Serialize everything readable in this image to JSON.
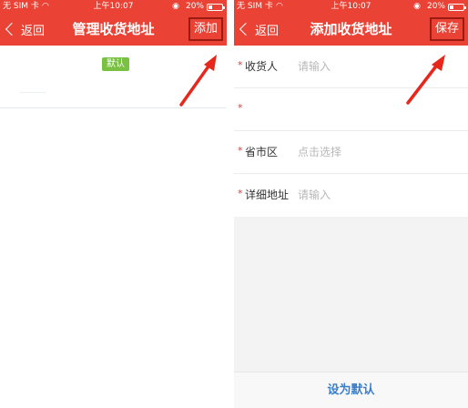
{
  "left": {
    "status": {
      "carrier": "无 SIM 卡",
      "time": "上午10:07",
      "battery": "20%"
    },
    "nav": {
      "back": "返回",
      "title": "管理收货地址",
      "action": "添加"
    },
    "badge": "默认"
  },
  "right": {
    "status": {
      "carrier": "无 SIM 卡",
      "time": "上午10:07",
      "battery": "20%"
    },
    "nav": {
      "back": "返回",
      "title": "添加收货地址",
      "action": "保存"
    },
    "form": {
      "rows": [
        {
          "star": "*",
          "label": "收货人",
          "placeholder": "请输入"
        },
        {
          "star": "*",
          "label": "",
          "placeholder": ""
        },
        {
          "star": "*",
          "label": "省市区",
          "placeholder": "点击选择"
        },
        {
          "star": "*",
          "label": "详细地址",
          "placeholder": "请输入"
        }
      ]
    },
    "set_default": "设为默认"
  },
  "colors": {
    "header": "#ea4335",
    "highlight_box": "#9b1b10",
    "arrow": "#e8271c",
    "default_badge": "#7ac143",
    "link_blue": "#3a7ec9"
  }
}
